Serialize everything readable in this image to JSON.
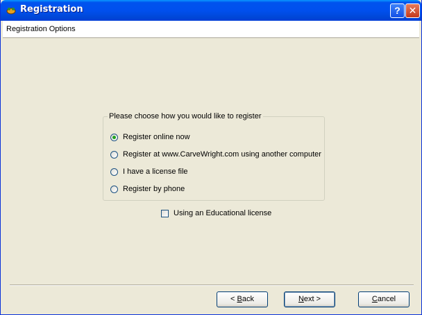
{
  "window": {
    "title": "Registration",
    "help_label": "?",
    "close_label": "✕"
  },
  "header": {
    "label": "Registration Options"
  },
  "options": {
    "legend": "Please choose how you would like to register",
    "items": [
      {
        "label": "Register online now",
        "checked": true
      },
      {
        "label": "Register at www.CarveWright.com using another computer",
        "checked": false
      },
      {
        "label": "I have a license file",
        "checked": false
      },
      {
        "label": "Register by phone",
        "checked": false
      }
    ]
  },
  "educational": {
    "label": "Using an Educational license",
    "checked": false
  },
  "buttons": {
    "back": {
      "prefix": "< ",
      "accel": "B",
      "rest": "ack"
    },
    "next": {
      "accel": "N",
      "rest": "ext >"
    },
    "cancel": {
      "accel": "C",
      "rest": "ancel"
    }
  },
  "colors": {
    "titlebar": "#0053ee",
    "dialog_bg": "#ece9d8",
    "radio_dot": "#21a121"
  }
}
